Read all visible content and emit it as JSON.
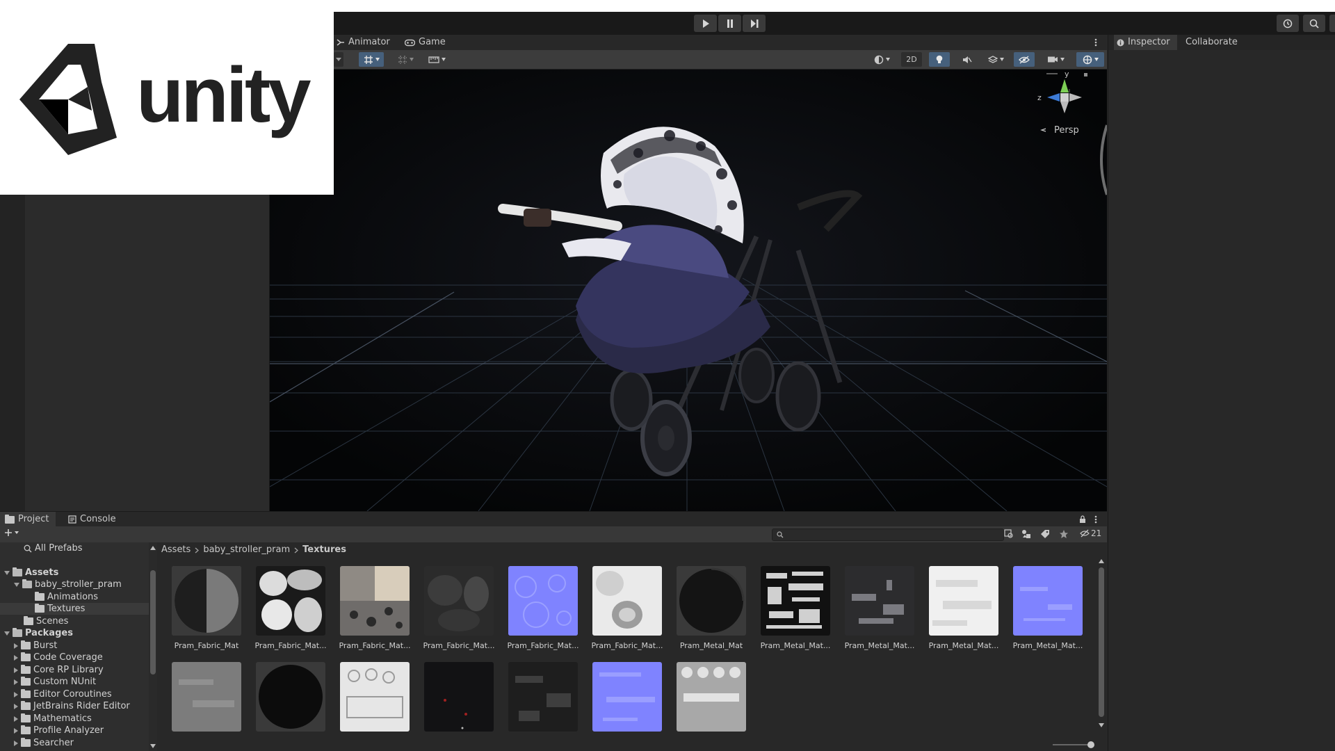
{
  "logo": {
    "text": "unity"
  },
  "scene_tabs": {
    "animator": "Animator",
    "game": "Game"
  },
  "scene_toolbar": {
    "mode_2d": "2D"
  },
  "gizmo": {
    "y_axis": "y",
    "z_axis": "z",
    "projection": "Persp"
  },
  "inspector": {
    "tab_inspector": "Inspector",
    "tab_collaborate": "Collaborate"
  },
  "project": {
    "tab_project": "Project",
    "tab_console": "Console",
    "hidden_count": "21",
    "tree": {
      "all_prefabs": "All Prefabs",
      "assets": "Assets",
      "baby_stroller_pram": "baby_stroller_pram",
      "animations": "Animations",
      "textures": "Textures",
      "scenes": "Scenes",
      "packages": "Packages",
      "package_items": [
        "Burst",
        "Code Coverage",
        "Core RP Library",
        "Custom NUnit",
        "Editor Coroutines",
        "JetBrains Rider Editor",
        "Mathematics",
        "Profile Analyzer",
        "Searcher"
      ]
    },
    "breadcrumb": {
      "root": "Assets",
      "folder": "baby_stroller_pram",
      "current": "Textures"
    },
    "assets_row1": [
      "Pram_Fabric_Mat",
      "Pram_Fabric_Mat...",
      "Pram_Fabric_Mat...",
      "Pram_Fabric_Mat...",
      "Pram_Fabric_Mat...",
      "Pram_Fabric_Mat...",
      "Pram_Metal_Mat",
      "Pram_Metal_Mat...",
      "Pram_Metal_Mat...",
      "Pram_Metal_Mat...",
      "Pram_Metal_Mat..."
    ]
  },
  "colors": {
    "editor_bg": "#282828",
    "toolbar_bg": "#191919",
    "accent_blue": "#46607c",
    "normal_map": "#7f83ff"
  },
  "icons": [
    "play-icon",
    "pause-icon",
    "step-icon",
    "history-icon",
    "search-icon",
    "menu-dots-icon",
    "folder-icon",
    "lock-icon",
    "star-icon",
    "tag-icon",
    "eye-slash-icon"
  ]
}
